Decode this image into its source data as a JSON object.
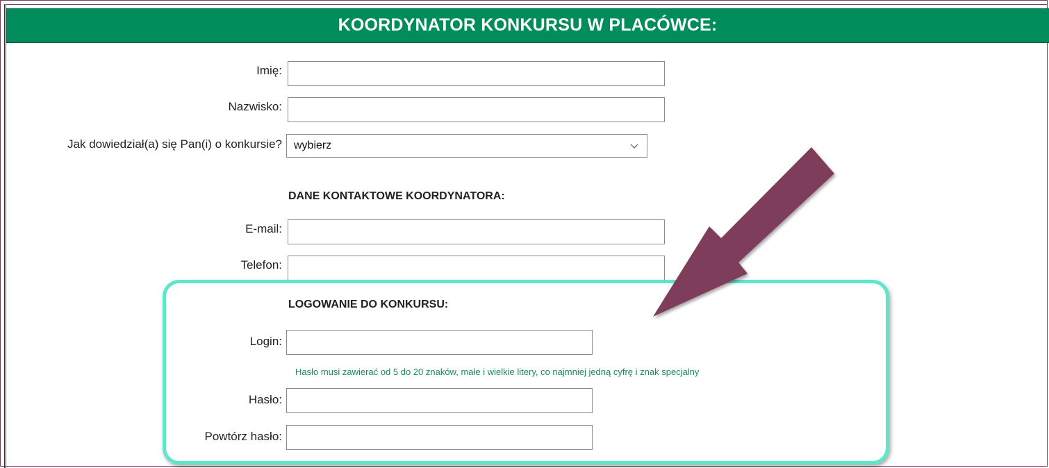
{
  "header": {
    "title": "KOORDYNATOR KONKURSU W PLACÓWCE:"
  },
  "form": {
    "first_name": {
      "label": "Imię:",
      "value": "",
      "placeholder": ""
    },
    "last_name": {
      "label": "Nazwisko:",
      "value": "",
      "placeholder": ""
    },
    "source": {
      "label": "Jak dowiedział(a) się Pan(i) o konkursie?",
      "selected": "wybierz"
    },
    "contact_section": {
      "title": "DANE KONTAKTOWE KOORDYNATORA:"
    },
    "email": {
      "label": "E-mail:",
      "value": "",
      "placeholder": ""
    },
    "phone": {
      "label": "Telefon:",
      "value": "",
      "placeholder": ""
    },
    "login_section": {
      "title": "LOGOWANIE DO KONKURSU:"
    },
    "login": {
      "label": "Login:",
      "value": "",
      "placeholder": ""
    },
    "password_hint": "Hasło musi zawierać od 5 do 20 znaków, małe i wielkie litery, co najmniej jedną cyfrę i znak specjalny",
    "password": {
      "label": "Hasło:",
      "value": "",
      "placeholder": ""
    },
    "password_repeat": {
      "label": "Powtórz hasło:",
      "value": "",
      "placeholder": ""
    }
  },
  "icons": {
    "select_chevron": "chevron-down-icon",
    "annotation_arrow": "arrow-down-left-icon"
  },
  "colors": {
    "header_bg": "#008c5b",
    "hint_text": "#1a8a5c",
    "highlight_border": "#5ee6c8",
    "arrow": "#7f3c5b"
  }
}
